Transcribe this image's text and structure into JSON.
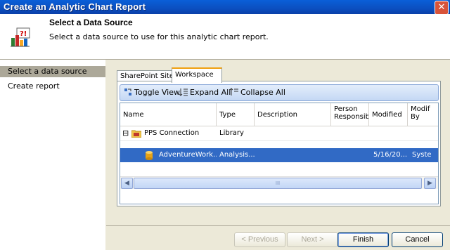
{
  "window": {
    "title": "Create an Analytic Chart Report",
    "close_glyph": "✕"
  },
  "header": {
    "title": "Select a Data Source",
    "subtitle": "Select a data source to use for this analytic chart report.",
    "icon": "chart-wizard-icon"
  },
  "leftnav": {
    "items": [
      {
        "label": "Select a data source",
        "selected": true
      },
      {
        "label": "Create report",
        "selected": false
      }
    ]
  },
  "tabs": [
    {
      "label": "SharePoint Site",
      "active": false
    },
    {
      "label": "Workspace",
      "active": true
    }
  ],
  "toolbar": {
    "toggle_view": "Toggle View",
    "expand_all": "Expand All",
    "collapse_all": "Collapse All"
  },
  "grid": {
    "columns": [
      "Name",
      "Type",
      "Description",
      "Person Responsibl",
      "Modified",
      "Modif By"
    ],
    "rows": [
      {
        "expander": "⊟",
        "name": "PPS Connection",
        "type": "Library",
        "description": "",
        "person": "",
        "modified": "",
        "modified_by": "",
        "icon": "folder-icon"
      },
      {
        "name": "AdventureWork...",
        "type": "Analysis...",
        "description": "",
        "person": "",
        "modified": "5/16/20...",
        "modified_by": "Syste",
        "icon": "database-icon",
        "selected": true
      }
    ],
    "scroll_glyph": "III"
  },
  "buttons": {
    "previous": "< Previous",
    "next": "Next >",
    "finish": "Finish",
    "cancel": "Cancel"
  }
}
